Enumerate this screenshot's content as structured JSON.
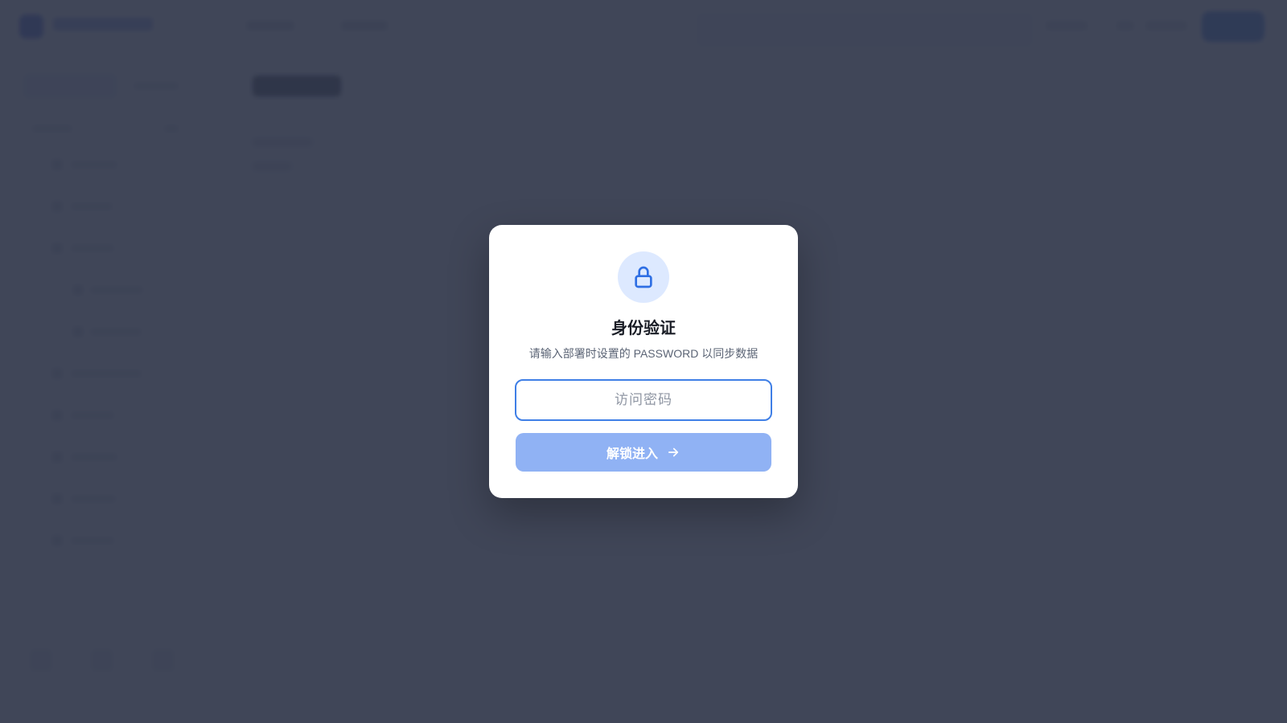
{
  "modal": {
    "title": "身份验证",
    "subtitle": "请输入部署时设置的 PASSWORD 以同步数据",
    "password_placeholder": "访问密码",
    "password_value": "",
    "unlock_label": "解锁进入",
    "icons": {
      "lock": "lock-icon",
      "arrow": "arrow-right-icon"
    }
  },
  "colors": {
    "accent": "#3f7fe6",
    "button_disabled": "#90b2f4",
    "icon_bg": "#dde9ff",
    "overlay": "#30364a"
  }
}
